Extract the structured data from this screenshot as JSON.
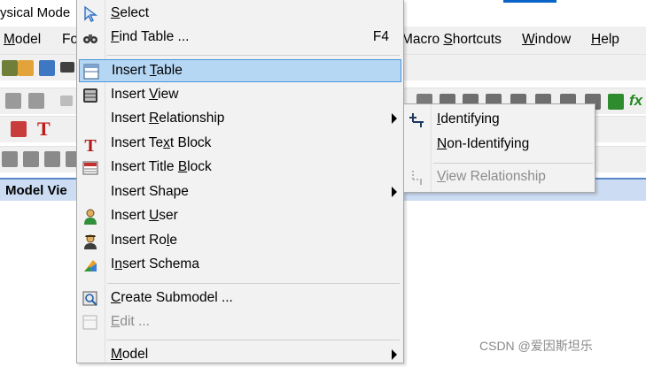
{
  "app": {
    "title": "ysical Mode",
    "menubar": {
      "model": "Model",
      "fo": "Fo",
      "macro": "Macro Shortcuts",
      "window": "Window",
      "help": "Help"
    },
    "model_tab": "Model Vie",
    "green_icon_text": "fx"
  },
  "menu": {
    "items": [
      {
        "pre": "",
        "u": "S",
        "post": "elect",
        "icon": "cursor-arrow-icon"
      },
      {
        "pre": "",
        "u": "F",
        "post": "ind Table ...",
        "shortcut": "F4",
        "icon": "binoculars-icon"
      },
      {
        "pre": "Insert ",
        "u": "T",
        "post": "able",
        "icon": "table-icon",
        "highlighted": true
      },
      {
        "pre": "Insert ",
        "u": "V",
        "post": "iew",
        "icon": "view-icon"
      },
      {
        "pre": "Insert ",
        "u": "R",
        "post": "elationship",
        "submenu": true
      },
      {
        "pre": "Insert Te",
        "u": "x",
        "post": "t Block",
        "icon": "text-block-icon"
      },
      {
        "pre": "Insert Title ",
        "u": "B",
        "post": "lock",
        "icon": "title-block-icon"
      },
      {
        "pre": "Insert Shape",
        "u": "",
        "post": "",
        "submenu": true
      },
      {
        "pre": "Insert ",
        "u": "U",
        "post": "ser",
        "icon": "user-icon"
      },
      {
        "pre": "Insert Ro",
        "u": "l",
        "post": "e",
        "icon": "role-icon"
      },
      {
        "pre": "I",
        "u": "n",
        "post": "sert Schema",
        "icon": "schema-icon"
      },
      {
        "pre": "",
        "u": "C",
        "post": "reate Submodel ...",
        "icon": "submodel-icon"
      },
      {
        "pre": "",
        "u": "E",
        "post": "dit ...",
        "icon": "edit-icon",
        "disabled": true
      },
      {
        "pre": "",
        "u": "M",
        "post": "odel",
        "submenu": true
      }
    ]
  },
  "submenu": {
    "items": [
      {
        "pre": "",
        "u": "I",
        "post": "dentifying",
        "icon": "identifying-relationship-icon"
      },
      {
        "pre": "",
        "u": "N",
        "post": "on-Identifying",
        "icon": ""
      },
      {
        "pre": "",
        "u": "V",
        "post": "iew Relationship",
        "icon": "view-relationship-icon",
        "disabled": true
      }
    ]
  },
  "watermark": "CSDN @爱因斯坦乐"
}
